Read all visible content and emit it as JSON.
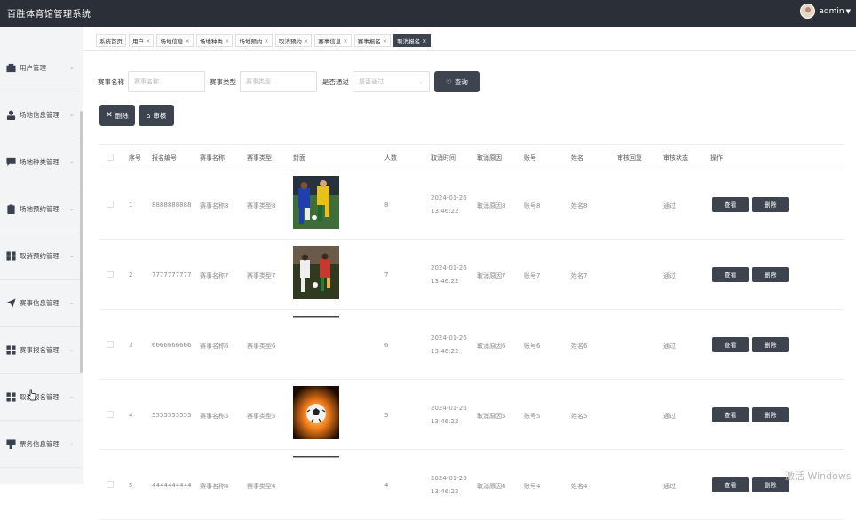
{
  "app": {
    "title": "百胜体育馆管理系统",
    "user": "admin"
  },
  "sidebar": {
    "items": [
      {
        "label": "用户管理",
        "icon": "user-card-icon"
      },
      {
        "label": "场地信息管理",
        "icon": "person-icon"
      },
      {
        "label": "场地种类管理",
        "icon": "chat-icon"
      },
      {
        "label": "场地预约管理",
        "icon": "clipboard-icon"
      },
      {
        "label": "取消预约管理",
        "icon": "grid-icon"
      },
      {
        "label": "赛事信息管理",
        "icon": "paper-plane-icon"
      },
      {
        "label": "赛事报名管理",
        "icon": "grid-icon"
      },
      {
        "label": "取消报名管理",
        "icon": "grid-icon"
      },
      {
        "label": "票务信息管理",
        "icon": "speech-icon"
      }
    ]
  },
  "tabs": [
    {
      "label": "系统首页",
      "closable": false,
      "active": false
    },
    {
      "label": "用户",
      "closable": true,
      "active": false
    },
    {
      "label": "场地信息",
      "closable": true,
      "active": false
    },
    {
      "label": "场地种类",
      "closable": true,
      "active": false
    },
    {
      "label": "场地预约",
      "closable": true,
      "active": false
    },
    {
      "label": "取消预约",
      "closable": true,
      "active": false
    },
    {
      "label": "赛事信息",
      "closable": true,
      "active": false
    },
    {
      "label": "赛事报名",
      "closable": true,
      "active": false
    },
    {
      "label": "取消报名",
      "closable": true,
      "active": true
    }
  ],
  "filters": {
    "name_label": "赛事名称",
    "name_placeholder": "赛事名称",
    "type_label": "赛事类型",
    "type_placeholder": "赛事类型",
    "pass_label": "是否通过",
    "pass_placeholder": "是否通过",
    "search_label": "查询"
  },
  "actions": {
    "delete_label": "删除",
    "review_label": "审核"
  },
  "table": {
    "headers": [
      "序号",
      "报名编号",
      "赛事名称",
      "赛事类型",
      "封面",
      "人数",
      "取消时间",
      "取消原因",
      "账号",
      "姓名",
      "审核回复",
      "审核状态",
      "操作"
    ],
    "view_label": "查看",
    "delete_label": "删除",
    "rows": [
      {
        "index": "1",
        "code": "8888888888",
        "name": "赛事名称8",
        "type": "赛事类型8",
        "cover": "soccer-players-blue-yellow",
        "count": "8",
        "date": "2024-01-26",
        "time": "13:46:22",
        "reason": "取消原因8",
        "account": "账号8",
        "person": "姓名8",
        "reply": "",
        "status": "通过"
      },
      {
        "index": "2",
        "code": "7777777777",
        "name": "赛事名称7",
        "type": "赛事类型7",
        "cover": "soccer-players-dark",
        "count": "7",
        "date": "2024-01-26",
        "time": "13:46:22",
        "reason": "取消原因7",
        "account": "账号7",
        "person": "姓名7",
        "reply": "",
        "status": "通过"
      },
      {
        "index": "3",
        "code": "6666666666",
        "name": "赛事名称6",
        "type": "赛事类型6",
        "cover": "loading",
        "count": "6",
        "date": "2024-01-26",
        "time": "13:46:22",
        "reason": "取消原因6",
        "account": "账号6",
        "person": "姓名6",
        "reply": "",
        "status": "通过"
      },
      {
        "index": "4",
        "code": "5555555555",
        "name": "赛事名称5",
        "type": "赛事类型5",
        "cover": "soccer-ball-fire",
        "count": "5",
        "date": "2024-01-26",
        "time": "13:46:22",
        "reason": "取消原因5",
        "account": "账号5",
        "person": "姓名5",
        "reply": "",
        "status": "通过"
      },
      {
        "index": "5",
        "code": "4444444444",
        "name": "赛事名称4",
        "type": "赛事类型4",
        "cover": "loading",
        "count": "4",
        "date": "2024-01-26",
        "time": "13:46:22",
        "reason": "取消原因4",
        "account": "账号4",
        "person": "姓名4",
        "reply": "",
        "status": "通过"
      }
    ]
  },
  "watermark": "激活 Windows"
}
